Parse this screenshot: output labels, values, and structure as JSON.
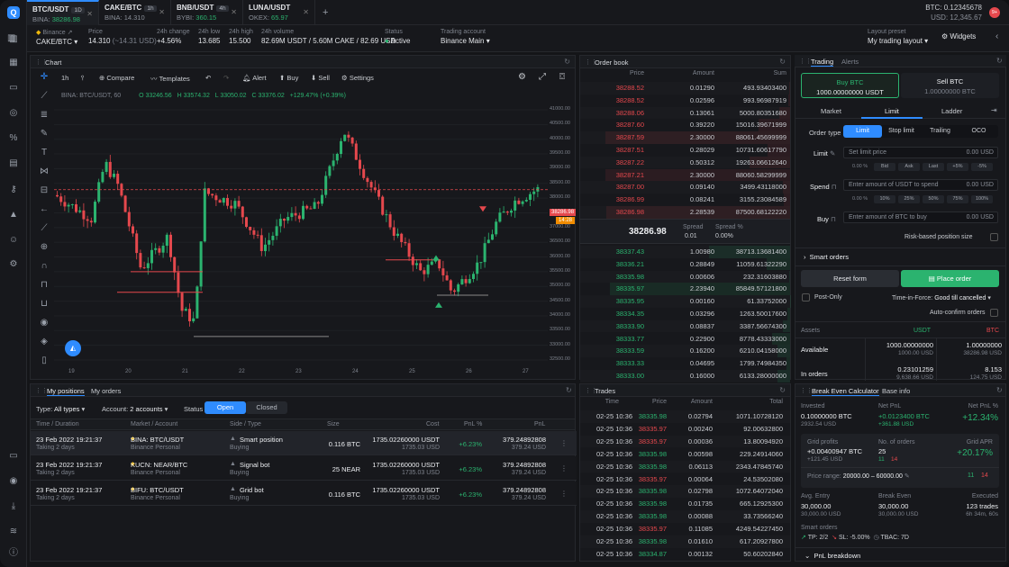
{
  "app": {
    "logo": "Q",
    "notif": "9+",
    "btc_label": "BTC: 0.12345678",
    "usd_label": "USD: 12,345.67",
    "preset_label": "Layout preset",
    "preset_value": "My trading layout",
    "widgets": "Widgets"
  },
  "tabs": [
    {
      "pair": "BTC/USDT",
      "tf": "1D",
      "exch": "BINA:",
      "price": "38286.98",
      "price_color": "#2bb36f"
    },
    {
      "pair": "CAKE/BTC",
      "tf": "1h",
      "exch": "BINA:",
      "price": "14.310",
      "price_color": "#8a8f98"
    },
    {
      "pair": "BNB/USDT",
      "tf": "4h",
      "exch": "BYBI:",
      "price": "360.15",
      "price_color": "#2bb36f"
    },
    {
      "pair": "LUNA/USDT",
      "tf": "1h",
      "exch": "OKEX:",
      "price": "65.97",
      "price_color": "#2bb36f"
    }
  ],
  "info": {
    "exchange": "Binance",
    "pair": "CAKE/BTC",
    "price_l": "Price",
    "price_v": "14.310",
    "price_sub": "(~14.31 USD)",
    "chg_l": "24h change",
    "chg_v": "+4.56%",
    "low_l": "24h low",
    "low_v": "13.685",
    "high_l": "24h high",
    "high_v": "15.500",
    "vol_l": "24h volume",
    "vol_v": "82.69M USDT / 5.60M CAKE / 82.69 USD",
    "status_l": "Status",
    "status_v": "Active",
    "acct_l": "Trading account",
    "acct_v": "Binance Main"
  },
  "chart": {
    "title": "Chart",
    "tf": "1h",
    "compare": "Compare",
    "templates": "Templates",
    "alert": "Alert",
    "buy": "Buy",
    "sell": "Sell",
    "settings": "Settings",
    "symbol": "BINA: BTC/USDT, 60",
    "o": "O 33246.56",
    "h": "H 33574.32",
    "l": "L 33050.02",
    "c": "C 33376.02",
    "chg": "+129.47% (+0.39%)",
    "y_ticks": [
      "41000.00",
      "40500.00",
      "40000.00",
      "39500.00",
      "39000.00",
      "38500.00",
      "38000.00",
      "37500.00",
      "37000.00",
      "36500.00",
      "36000.00",
      "35500.00",
      "35000.00",
      "34500.00",
      "34000.00",
      "33500.00",
      "33000.00",
      "32500.00"
    ],
    "x_ticks": [
      "19",
      "20",
      "21",
      "22",
      "23",
      "24",
      "25",
      "26",
      "27"
    ],
    "price_tag": "38286.98",
    "time_tag": "14:28"
  },
  "orderbook": {
    "title": "Order book",
    "cols": [
      "Price",
      "Amount",
      "Sum"
    ],
    "asks": [
      [
        "38288.52",
        "0.01290",
        "493.93403400"
      ],
      [
        "38288.52",
        "0.02596",
        "993.96987919"
      ],
      [
        "38288.06",
        "0.13061",
        "5000.80351680"
      ],
      [
        "38287.60",
        "0.39220",
        "15016.39671999"
      ],
      [
        "38287.59",
        "2.30000",
        "88061.45699999"
      ],
      [
        "38287.51",
        "0.28029",
        "10731.60617790"
      ],
      [
        "38287.22",
        "0.50312",
        "19263.06612640"
      ],
      [
        "38287.21",
        "2.30000",
        "88060.58299999"
      ],
      [
        "38287.00",
        "0.09140",
        "3499.43118000"
      ],
      [
        "38286.99",
        "0.08241",
        "3155.23084589"
      ],
      [
        "38286.98",
        "2.28539",
        "87500.68122220"
      ]
    ],
    "mid": "38286.98",
    "spread_l": "Spread",
    "spread_v": "0.01",
    "spreadp_l": "Spread %",
    "spreadp_v": "0.00%",
    "bids": [
      [
        "38337.43",
        "1.00980",
        "38713.13681400"
      ],
      [
        "38336.21",
        "0.28849",
        "11059.61322290"
      ],
      [
        "38335.98",
        "0.00606",
        "232.31603880"
      ],
      [
        "38335.97",
        "2.23940",
        "85849.57121800"
      ],
      [
        "38335.95",
        "0.00160",
        "61.33752000"
      ],
      [
        "38334.35",
        "0.03296",
        "1263.50017600"
      ],
      [
        "38333.90",
        "0.08837",
        "3387.56674300"
      ],
      [
        "38333.77",
        "0.22900",
        "8778.43333000"
      ],
      [
        "38333.59",
        "0.16200",
        "6210.04158000"
      ],
      [
        "38333.33",
        "0.04695",
        "1799.74984350"
      ],
      [
        "38333.00",
        "0.16000",
        "6133.28000000"
      ]
    ]
  },
  "trading": {
    "tab1": "Trading",
    "tab2": "Alerts",
    "buy_l": "Buy BTC",
    "buy_v": "1000.00000000 USDT",
    "sell_l": "Sell BTC",
    "sell_v": "1.00000000 BTC",
    "types": [
      "Market",
      "Limit",
      "Ladder"
    ],
    "ordertype_l": "Order type",
    "ot": [
      "Limit",
      "Stop limit",
      "Trailing",
      "OCO"
    ],
    "limit_l": "Limit",
    "limit_ph": "Set limit price",
    "limit_usd": "0.00 USD",
    "pct0": "0.00 %",
    "lim_btns": [
      "Bid",
      "Ask",
      "Last",
      "+5%",
      "-5%"
    ],
    "spend_l": "Spend",
    "spend_ph": "Enter amount of USDT to spend",
    "spend_usd": "0.00 USD",
    "pct_btns": [
      "10%",
      "25%",
      "50%",
      "75%",
      "100%"
    ],
    "buy_f_l": "Buy",
    "buy_ph": "Enter amount of BTC to buy",
    "buy_usd": "0.00 USD",
    "risk": "Risk-based position size",
    "smart": "Smart orders",
    "reset": "Reset form",
    "place": "Place order",
    "postonly": "Post-Only",
    "tif_l": "Time-in-Force:",
    "tif_v": "Good till cancelled",
    "autoconf": "Auto-confirm orders",
    "assets": {
      "h": [
        "Assets",
        "USDT",
        "BTC"
      ],
      "avail_l": "Available",
      "avail_usdt": "1000.00000000",
      "avail_usdt2": "1000.00 USD",
      "avail_btc": "1.00000000",
      "avail_btc2": "38286.98 USD",
      "inord_l": "In orders",
      "inord_usdt": "0.23101259",
      "inord_usdt2": "9,638.66 USD",
      "inord_btc": "8.153",
      "inord_btc2": "124.75 USD"
    }
  },
  "positions": {
    "tab1": "My positions",
    "tab2": "My orders",
    "type_l": "Type:",
    "type_v": "All types",
    "acct_l": "Account:",
    "acct_v": "2 accounts",
    "status_l": "Status",
    "open": "Open",
    "closed": "Closed",
    "cols": [
      "Time / Duration",
      "Market / Account",
      "Side / Type",
      "Size",
      "Cost",
      "PnL %",
      "PnL"
    ],
    "rows": [
      {
        "time": "23 Feb 2022 19:21:37",
        "dur": "Taking 2 days",
        "market": "BINA: BTC/USDT",
        "acct": "Binance Personal",
        "type": "Smart position",
        "side": "Buying",
        "size": "0.116 BTC",
        "cost": "1735.02260000 USDT",
        "cost2": "1735.03 USD",
        "pnlp": "+6.23%",
        "pnl": "379.24892808",
        "pnl2": "379.24 USD"
      },
      {
        "time": "23 Feb 2022 19:21:37",
        "dur": "Taking 2 days",
        "market": "KUCN: NEAR/BTC",
        "acct": "Binance Personal",
        "type": "Signal bot",
        "side": "Buying",
        "size": "25 NEAR",
        "cost": "1735.02260000 USDT",
        "cost2": "1735.03 USD",
        "pnlp": "+6.23%",
        "pnl": "379.24892808",
        "pnl2": "379.24 USD"
      },
      {
        "time": "23 Feb 2022 19:21:37",
        "dur": "Taking 2 days",
        "market": "BIFU: BTC/USDT",
        "acct": "Binance Personal",
        "type": "Grid bot",
        "side": "Buying",
        "size": "0.116 BTC",
        "cost": "1735.02260000 USDT",
        "cost2": "1735.03 USD",
        "pnlp": "+6.23%",
        "pnl": "379.24892808",
        "pnl2": "379.24 USD"
      }
    ]
  },
  "trades": {
    "title": "Trades",
    "cols": [
      "Time",
      "Price",
      "Amount",
      "Total"
    ],
    "rows": [
      [
        "02-25 10:36",
        "38335.98",
        "0.02794",
        "1071.10728120",
        "g"
      ],
      [
        "02-25 10:36",
        "38335.97",
        "0.00240",
        "92.00632800",
        "r"
      ],
      [
        "02-25 10:36",
        "38335.97",
        "0.00036",
        "13.80094920",
        "r"
      ],
      [
        "02-25 10:36",
        "38335.98",
        "0.00598",
        "229.24914060",
        "g"
      ],
      [
        "02-25 10:36",
        "38335.98",
        "0.06113",
        "2343.47845740",
        "g"
      ],
      [
        "02-25 10:36",
        "38335.97",
        "0.00064",
        "24.53502080",
        "r"
      ],
      [
        "02-25 10:36",
        "38335.98",
        "0.02798",
        "1072.64072040",
        "g"
      ],
      [
        "02-25 10:36",
        "38335.98",
        "0.01735",
        "665.12925300",
        "g"
      ],
      [
        "02-25 10:36",
        "38335.98",
        "0.00088",
        "33.73566240",
        "g"
      ],
      [
        "02-25 10:36",
        "38335.97",
        "0.11085",
        "4249.54227450",
        "r"
      ],
      [
        "02-25 10:36",
        "38335.98",
        "0.01610",
        "617.20927800",
        "g"
      ],
      [
        "02-25 10:36",
        "38334.87",
        "0.00132",
        "50.60202840",
        "g"
      ]
    ]
  },
  "bec": {
    "tab1": "Break Even Calculator",
    "tab2": "Base info",
    "inv_l": "Invested",
    "inv_v": "0.10000000 BTC",
    "inv_s": "2932.54 USD",
    "net_l": "Net PnL",
    "net_v": "+0.0123400 BTC",
    "net_s": "+361.88 USD",
    "netp_l": "Net PnL %",
    "netp_v": "+12.34%",
    "gp_l": "Grid profits",
    "gp_v": "+0.00400947 BTC",
    "gp_s": "+121.45 USD",
    "no_l": "No. of orders",
    "no_v": "25",
    "no_a": "11",
    "no_b": "14",
    "apr_l": "Grid APR",
    "apr_v": "+20.17%",
    "range_l": "Price range:",
    "range_v": "20000.00 – 60000.00",
    "r_a": "11",
    "r_b": "14",
    "avg_l": "Avg. Entry",
    "avg_v": "30,000.00",
    "avg_s": "30,000.00 USD",
    "be_l": "Break Even",
    "be_v": "30,000.00",
    "be_s": "30,000.00 USD",
    "ex_l": "Executed",
    "ex_v": "123 trades",
    "ex_s": "6h 34m, 60s",
    "so_l": "Smart orders",
    "tp": "TP: 2/2",
    "sl": "SL: -5.00%",
    "tbac": "TBAC: 7D",
    "pnlb": "PnL breakdown"
  }
}
